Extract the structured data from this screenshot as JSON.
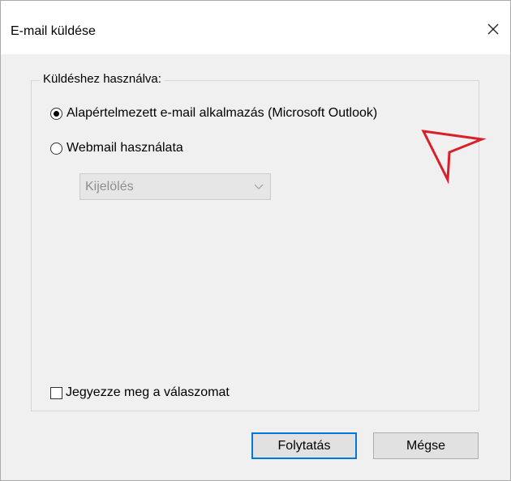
{
  "dialog": {
    "title": "E-mail küldése",
    "close_icon": "close-icon"
  },
  "group": {
    "label": "Küldéshez használva:",
    "options": [
      {
        "label": "Alapértelmezett e-mail alkalmazás (Microsoft Outlook)",
        "checked": true
      },
      {
        "label": "Webmail használata",
        "checked": false
      }
    ],
    "webmail_select": {
      "value": "Kijelölés",
      "disabled": true
    },
    "remember": {
      "label": "Jegyezze meg a válaszomat",
      "checked": false
    }
  },
  "buttons": {
    "continue_label": "Folytatás",
    "cancel_label": "Mégse"
  },
  "colors": {
    "accent": "#0078d7",
    "annotation_arrow": "#d9202a",
    "dialog_bg": "#f0f0f0"
  }
}
